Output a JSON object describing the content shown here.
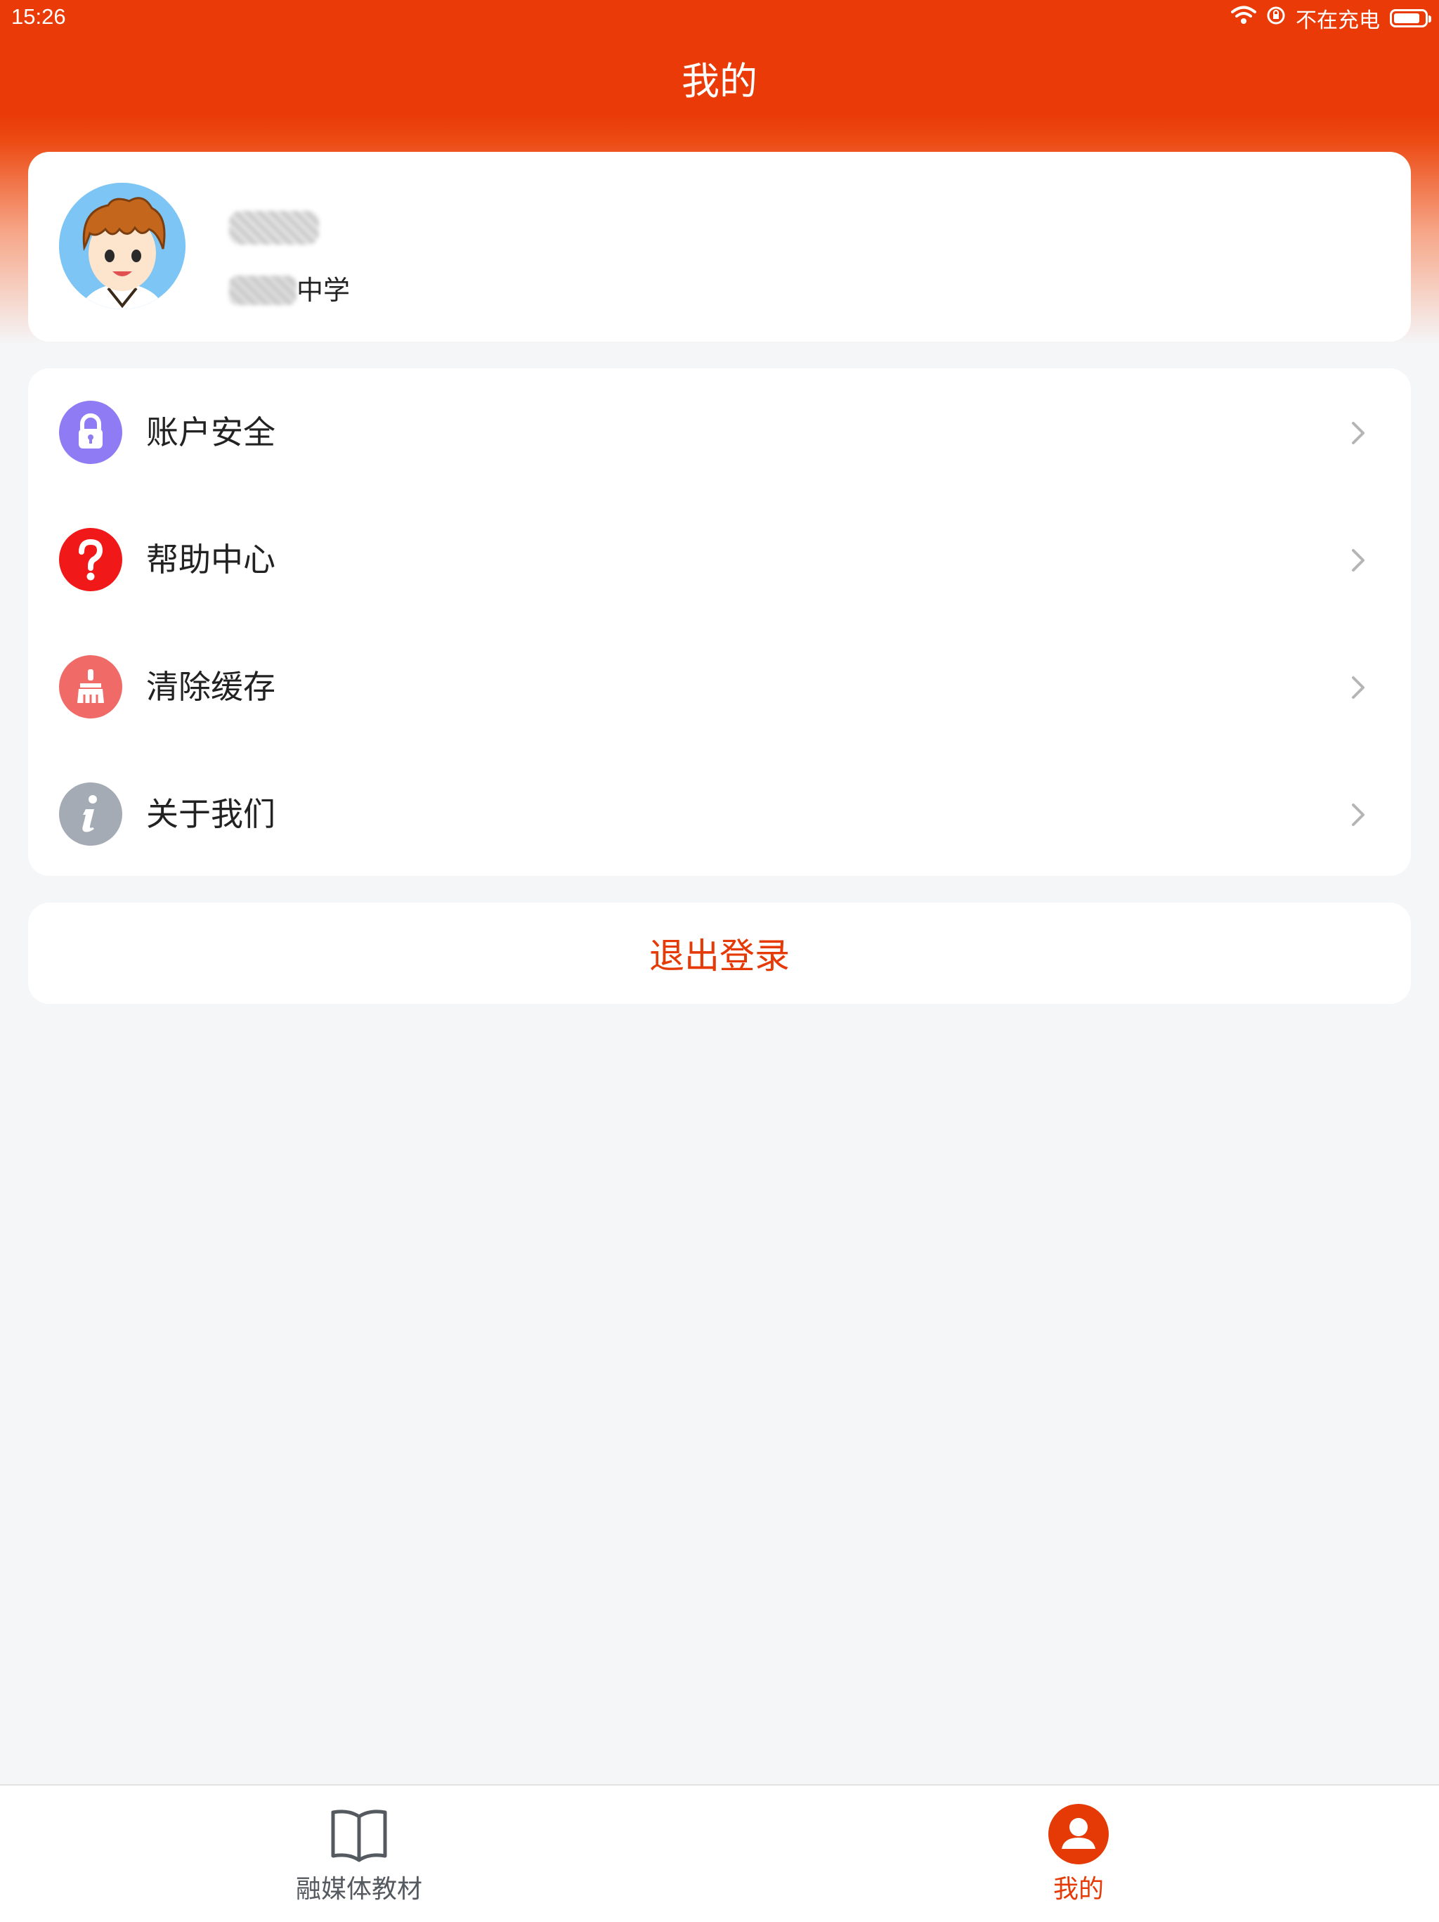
{
  "status_bar": {
    "time": "15:26",
    "charging_text": "不在充电",
    "battery_level": 0.85
  },
  "header": {
    "title": "我的"
  },
  "profile": {
    "school_suffix": "中学"
  },
  "menu": {
    "items": [
      {
        "label": "账户安全",
        "icon": "lock-icon",
        "color": "#8f7cf5"
      },
      {
        "label": "帮助中心",
        "icon": "question-icon",
        "color": "#f01818"
      },
      {
        "label": "清除缓存",
        "icon": "broom-icon",
        "color": "#f06b67"
      },
      {
        "label": "关于我们",
        "icon": "info-icon",
        "color": "#a4abb4"
      }
    ]
  },
  "logout": {
    "label": "退出登录"
  },
  "tabbar": {
    "tabs": [
      {
        "label": "融媒体教材",
        "icon": "book-icon",
        "active": false
      },
      {
        "label": "我的",
        "icon": "user-icon",
        "active": true
      }
    ]
  },
  "colors": {
    "brand": "#e93a07",
    "active_tab": "#e63a06",
    "inactive_tab": "#555a60",
    "background": "#f5f6f8"
  }
}
